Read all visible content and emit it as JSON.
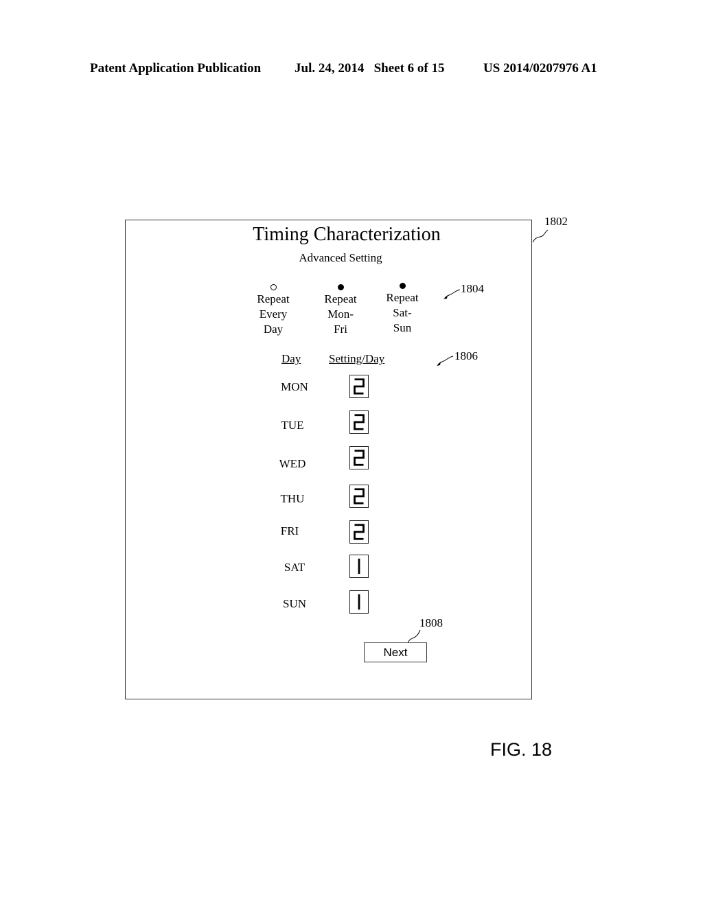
{
  "header": {
    "publication": "Patent Application Publication",
    "date_sheet": "Jul. 24, 2014   Sheet 6 of 15",
    "number": "US 2014/0207976 A1"
  },
  "screen": {
    "title": "Timing Characterization",
    "subtitle": "Advanced Setting",
    "ref_frame": "1802",
    "ref_radio": "1804",
    "ref_table": "1806",
    "ref_next": "1808",
    "radio_options": [
      {
        "label": "Repeat\nEvery\nDay",
        "selected": false
      },
      {
        "label": "Repeat\nMon-\nFri",
        "selected": true
      },
      {
        "label": "Repeat\nSat-\nSun",
        "selected": true
      }
    ],
    "table": {
      "col_day": "Day",
      "col_setting": "Setting/Day",
      "rows": [
        {
          "day": "MON",
          "setting": 2
        },
        {
          "day": "TUE",
          "setting": 2
        },
        {
          "day": "WED",
          "setting": 2
        },
        {
          "day": "THU",
          "setting": 2
        },
        {
          "day": "FRI",
          "setting": 2
        },
        {
          "day": "SAT",
          "setting": 1
        },
        {
          "day": "SUN",
          "setting": 1
        }
      ]
    },
    "next_label": "Next"
  },
  "figure_label": "FIG. 18"
}
